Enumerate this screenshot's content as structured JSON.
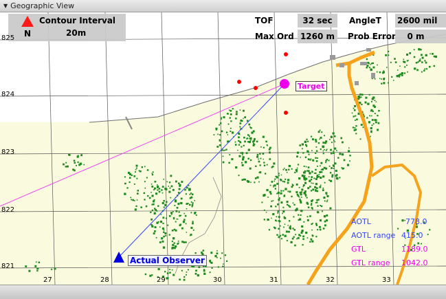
{
  "window": {
    "title": "Geographic View"
  },
  "contour": {
    "title": "Contour Interval",
    "value": "20m",
    "north": "N"
  },
  "info": {
    "tof_label": "TOF",
    "tof_value": "32 sec",
    "angle_label": "AngleT",
    "angle_value": "2600 mil",
    "maxord_label": "Max Ord",
    "maxord_value": "1260 m",
    "proberr_label": "Prob Error",
    "proberr_value": "0 m"
  },
  "grid": {
    "x_labels": [
      "27",
      "28",
      "29",
      "30",
      "31",
      "32",
      "33"
    ],
    "y_labels": [
      "825",
      "824",
      "823",
      "822",
      "821"
    ]
  },
  "markers": {
    "target": "Target",
    "observer": "Actual Observer"
  },
  "stats": {
    "aotl_label": "AOTL",
    "aotl_value": "778.0",
    "aotl_range_label": "AOTL range",
    "aotl_range_value": "415.0",
    "gtl_label": "GTL",
    "gtl_value": "1189.0",
    "gtl_range_label": "GTL range",
    "gtl_range_value": "1042.0"
  },
  "colors": {
    "land": "#fafadf",
    "forest": "#1f8a1f",
    "road": "#f5a21c",
    "target": "#ee00ee",
    "observer": "#0000dd",
    "gtl_line": "#ee44ee",
    "aotl_line": "#3344ff",
    "rocks": "#ff0000"
  }
}
